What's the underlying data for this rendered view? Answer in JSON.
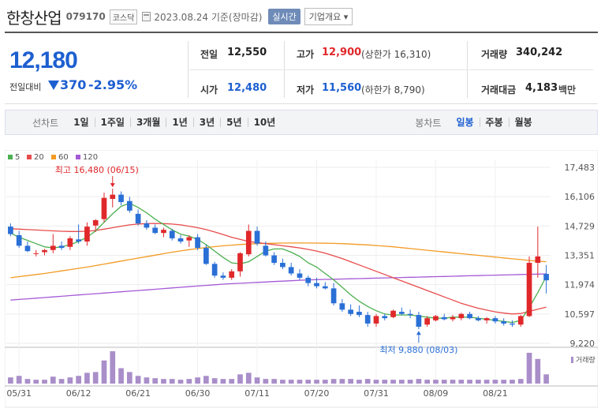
{
  "header": {
    "company_name": "한창산업",
    "code": "079170",
    "market_badge": "코스닥",
    "date_text": "2023.08.24 기준(장마감)",
    "realtime_button": "실시간",
    "info_button": "기업개요 ▾"
  },
  "price": {
    "current": "12,180",
    "change_label": "전일대비",
    "change_value": "370",
    "change_pct": "-2.95%"
  },
  "stats": {
    "prev_close_label": "전일",
    "prev_close": "12,550",
    "open_label": "시가",
    "open": "12,480",
    "high_label": "고가",
    "high": "12,900",
    "upper_limit": "(상한가 16,310)",
    "low_label": "저가",
    "low": "11,560",
    "lower_limit": "(하한가 8,790)",
    "volume_label": "거래량",
    "volume": "340,242",
    "amount_label": "거래대금",
    "amount": "4,183",
    "amount_unit": "백만"
  },
  "period_bar": {
    "line_title": "선차트",
    "line_items": [
      "1일",
      "1주일",
      "3개월",
      "1년",
      "3년",
      "5년",
      "10년"
    ],
    "candle_title": "봉차트",
    "candle_items": [
      "일봉",
      "주봉",
      "월봉"
    ],
    "active_candle": "일봉"
  },
  "colors": {
    "up": "#e0282b",
    "down": "#2a6fd6",
    "ma5": "#4caf50",
    "ma20": "#e84b4b",
    "ma60": "#f39a23",
    "ma120": "#a45ad6"
  },
  "chart_data": {
    "type": "candlestick",
    "legend": [
      {
        "name": "5",
        "color": "#4caf50"
      },
      {
        "name": "20",
        "color": "#e84b4b"
      },
      {
        "name": "60",
        "color": "#f39a23"
      },
      {
        "name": "120",
        "color": "#a45ad6"
      }
    ],
    "y_ticks": [
      "17,483",
      "16,106",
      "14,729",
      "13,351",
      "11,974",
      "10,597",
      "9,220"
    ],
    "ylim": [
      9220,
      17483
    ],
    "x_ticks": [
      "05/31",
      "06/12",
      "06/21",
      "06/30",
      "07/11",
      "07/20",
      "07/31",
      "08/09",
      "08/21"
    ],
    "x_tick_index": [
      1,
      8,
      15,
      22,
      29,
      36,
      43,
      50,
      57
    ],
    "high_annotation": "최고 16,480 (06/15)",
    "low_annotation": "최저 9,880 (08/03)",
    "volume_label": "거래량",
    "candles": [
      [
        14700,
        14850,
        14250,
        14350
      ],
      [
        14300,
        14500,
        13700,
        13800
      ],
      [
        13800,
        14000,
        13500,
        13550
      ],
      [
        13450,
        13600,
        13300,
        13450
      ],
      [
        13500,
        13650,
        13350,
        13600
      ],
      [
        13600,
        14350,
        13450,
        13800
      ],
      [
        13800,
        14000,
        13600,
        13700
      ],
      [
        13750,
        14250,
        13600,
        14150
      ],
      [
        14100,
        14800,
        13900,
        14000
      ],
      [
        14000,
        14900,
        13800,
        14700
      ],
      [
        14750,
        15050,
        14450,
        15000
      ],
      [
        15050,
        16300,
        14900,
        16050
      ],
      [
        16000,
        16480,
        15600,
        16200
      ],
      [
        16200,
        16350,
        15700,
        15850
      ],
      [
        15900,
        16100,
        15350,
        15450
      ],
      [
        15300,
        15500,
        14750,
        14850
      ],
      [
        14850,
        15000,
        14550,
        14650
      ],
      [
        14650,
        14800,
        14350,
        14400
      ],
      [
        14400,
        14650,
        14200,
        14550
      ],
      [
        14500,
        14600,
        14050,
        14150
      ],
      [
        14150,
        14300,
        13900,
        14000
      ],
      [
        14050,
        14300,
        13750,
        14200
      ],
      [
        14200,
        14350,
        13600,
        13700
      ],
      [
        13700,
        13850,
        12900,
        12950
      ],
      [
        12950,
        13050,
        12300,
        12400
      ],
      [
        12400,
        12550,
        12200,
        12300
      ],
      [
        12300,
        12700,
        12200,
        12600
      ],
      [
        12600,
        13500,
        12350,
        13450
      ],
      [
        13400,
        14800,
        13300,
        14500
      ],
      [
        14500,
        14700,
        13800,
        13900
      ],
      [
        13800,
        14000,
        13300,
        13350
      ],
      [
        13350,
        13500,
        12900,
        13000
      ],
      [
        13000,
        13200,
        12700,
        12800
      ],
      [
        12800,
        13000,
        12400,
        12500
      ],
      [
        12500,
        12700,
        12200,
        12300
      ],
      [
        12300,
        12400,
        11900,
        12050
      ],
      [
        12050,
        12300,
        11800,
        11900
      ],
      [
        11900,
        12100,
        11750,
        11800
      ],
      [
        11800,
        12050,
        11000,
        11100
      ],
      [
        11100,
        11300,
        10700,
        10800
      ],
      [
        10800,
        11050,
        10500,
        10600
      ],
      [
        10700,
        11000,
        10450,
        10550
      ],
      [
        10550,
        10700,
        10000,
        10150
      ],
      [
        10150,
        10600,
        10000,
        10500
      ],
      [
        10500,
        10600,
        10300,
        10400
      ],
      [
        10450,
        10800,
        10400,
        10750
      ],
      [
        10700,
        10900,
        10550,
        10600
      ],
      [
        10600,
        10800,
        10400,
        10550
      ],
      [
        10550,
        10700,
        9880,
        10000
      ],
      [
        10100,
        10500,
        10000,
        10400
      ],
      [
        10300,
        10550,
        10250,
        10500
      ],
      [
        10450,
        10600,
        10300,
        10350
      ],
      [
        10350,
        10550,
        10250,
        10450
      ],
      [
        10400,
        10650,
        10300,
        10600
      ],
      [
        10600,
        10700,
        10350,
        10400
      ],
      [
        10400,
        10500,
        10250,
        10300
      ],
      [
        10300,
        10450,
        10150,
        10400
      ],
      [
        10400,
        10500,
        10150,
        10250
      ],
      [
        10250,
        10400,
        10050,
        10150
      ],
      [
        10150,
        10300,
        10000,
        10100
      ],
      [
        10100,
        10550,
        10000,
        10500
      ],
      [
        10500,
        13300,
        10450,
        13000
      ],
      [
        13000,
        14700,
        12300,
        13300
      ],
      [
        12480,
        12900,
        11560,
        12180
      ]
    ],
    "ma5": [
      14400,
      14200,
      14050,
      13900,
      13750,
      13700,
      13750,
      13850,
      14000,
      14200,
      14500,
      14900,
      15300,
      15650,
      15800,
      15600,
      15350,
      15050,
      14800,
      14550,
      14350,
      14250,
      14100,
      13850,
      13550,
      13250,
      13000,
      12950,
      13050,
      13300,
      13550,
      13650,
      13650,
      13500,
      13300,
      13000,
      12800,
      12500,
      12200,
      11850,
      11500,
      11200,
      10950,
      10750,
      10600,
      10550,
      10550,
      10550,
      10500,
      10450,
      10400,
      10400,
      10450,
      10450,
      10450,
      10400,
      10350,
      10300,
      10250,
      10200,
      10300,
      10900,
      11600,
      12350
    ],
    "ma20": [
      14600,
      14580,
      14560,
      14540,
      14520,
      14500,
      14480,
      14470,
      14470,
      14480,
      14520,
      14580,
      14650,
      14720,
      14780,
      14820,
      14840,
      14850,
      14840,
      14820,
      14780,
      14720,
      14650,
      14560,
      14450,
      14330,
      14200,
      14100,
      14000,
      13950,
      13900,
      13850,
      13800,
      13750,
      13700,
      13630,
      13550,
      13450,
      13330,
      13200,
      13050,
      12900,
      12750,
      12600,
      12450,
      12300,
      12150,
      12000,
      11850,
      11700,
      11550,
      11400,
      11250,
      11100,
      10980,
      10870,
      10780,
      10700,
      10640,
      10600,
      10620,
      10720,
      10820,
      10920
    ],
    "ma60": [
      12300,
      12350,
      12400,
      12450,
      12500,
      12560,
      12620,
      12680,
      12740,
      12800,
      12870,
      12940,
      13010,
      13080,
      13150,
      13220,
      13290,
      13360,
      13430,
      13500,
      13560,
      13620,
      13670,
      13720,
      13760,
      13800,
      13830,
      13860,
      13880,
      13900,
      13910,
      13920,
      13925,
      13930,
      13930,
      13930,
      13925,
      13920,
      13910,
      13900,
      13880,
      13860,
      13840,
      13810,
      13780,
      13750,
      13710,
      13670,
      13630,
      13590,
      13550,
      13510,
      13470,
      13430,
      13390,
      13350,
      13310,
      13270,
      13230,
      13190,
      13150,
      13110,
      13080,
      13050
    ],
    "ma120": [
      11250,
      11280,
      11310,
      11340,
      11370,
      11400,
      11430,
      11460,
      11490,
      11520,
      11550,
      11580,
      11610,
      11640,
      11670,
      11700,
      11730,
      11760,
      11790,
      11820,
      11850,
      11880,
      11910,
      11940,
      11970,
      12000,
      12020,
      12040,
      12060,
      12080,
      12100,
      12120,
      12140,
      12160,
      12180,
      12200,
      12210,
      12220,
      12230,
      12240,
      12250,
      12260,
      12270,
      12280,
      12290,
      12300,
      12310,
      12320,
      12330,
      12340,
      12350,
      12360,
      12370,
      12380,
      12390,
      12400,
      12410,
      12420,
      12430,
      12440,
      12450,
      12460,
      12470,
      12480
    ],
    "volume": [
      8,
      10,
      6,
      5,
      5,
      9,
      6,
      8,
      10,
      14,
      15,
      30,
      42,
      20,
      15,
      10,
      8,
      7,
      6,
      6,
      5,
      6,
      8,
      10,
      7,
      6,
      6,
      12,
      14,
      8,
      6,
      6,
      5,
      5,
      5,
      5,
      5,
      5,
      6,
      6,
      6,
      5,
      6,
      5,
      5,
      5,
      5,
      5,
      6,
      5,
      5,
      5,
      5,
      5,
      5,
      5,
      5,
      5,
      5,
      5,
      6,
      40,
      32,
      12
    ]
  }
}
